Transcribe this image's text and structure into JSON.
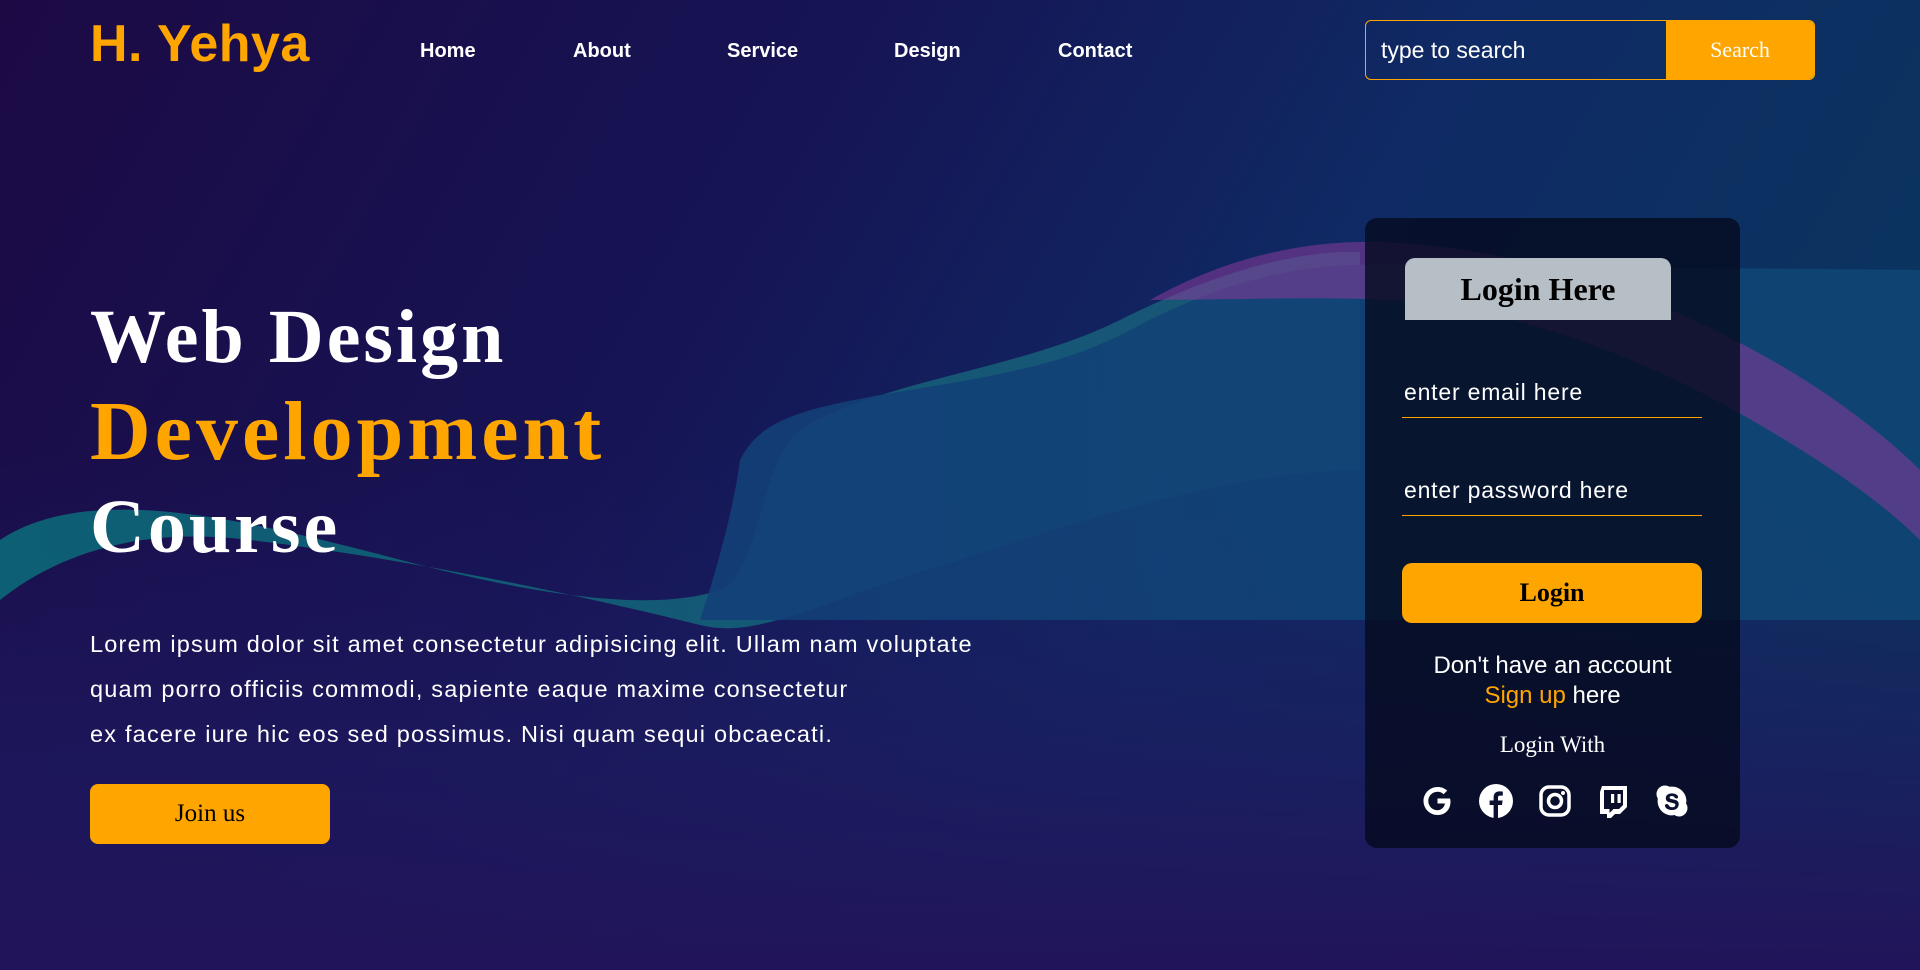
{
  "header": {
    "logo": "H. Yehya",
    "nav": [
      "Home",
      "About",
      "Service",
      "Design",
      "Contact"
    ],
    "search": {
      "placeholder": "type to search",
      "button_label": "Search"
    }
  },
  "hero": {
    "title_line1": "Web Design",
    "title_line2": "Development",
    "title_line3": "Course",
    "paragraph_lines": [
      "Lorem ipsum dolor sit amet consectetur adipisicing elit. Ullam nam voluptate",
      "quam porro officiis commodi, sapiente eaque maxime consectetur",
      "ex facere iure hic eos sed possimus. Nisi quam sequi obcaecati."
    ],
    "join_label": "Join us"
  },
  "login": {
    "title": "Login Here",
    "email_placeholder": "enter email here",
    "password_placeholder": "enter password here",
    "button_label": "Login",
    "signup_prefix": "Don't have an account",
    "signup_link": "Sign up",
    "signup_suffix": " here",
    "login_with": "Login With",
    "social_icons": [
      "google-icon",
      "facebook-icon",
      "instagram-icon",
      "twitch-icon",
      "skype-icon"
    ]
  },
  "colors": {
    "accent": "#ffa500",
    "text": "#ffffff",
    "card_header": "#b6bec6"
  }
}
